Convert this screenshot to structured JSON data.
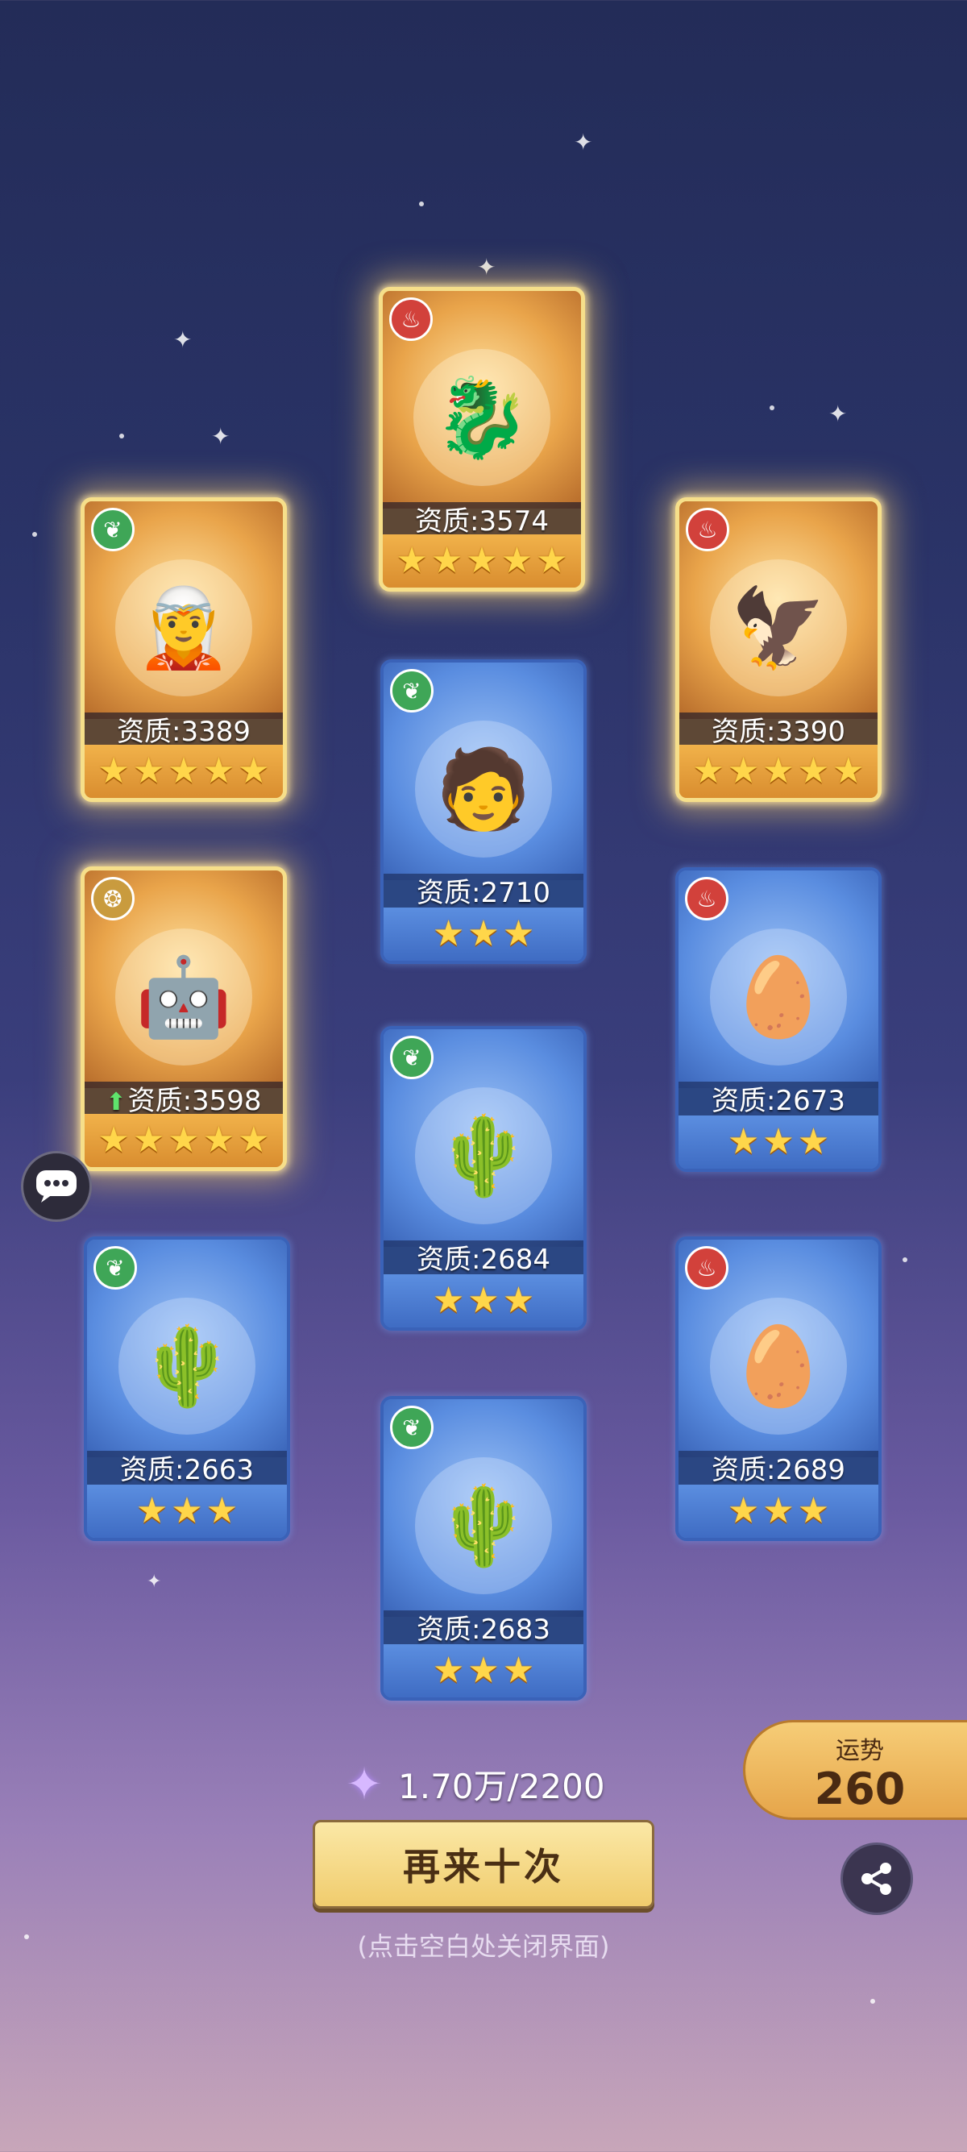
{
  "cards": [
    {
      "id": "c1",
      "rarity": "gold",
      "element": "fire",
      "element_icon": "fire-element-icon",
      "figure": "🐉",
      "quality": "资质:3574",
      "stars": 5,
      "upgrade": false
    },
    {
      "id": "c2",
      "rarity": "gold",
      "element": "nature",
      "element_icon": "nature-element-icon",
      "figure": "🧝",
      "quality": "资质:3389",
      "stars": 5,
      "upgrade": false
    },
    {
      "id": "c3",
      "rarity": "gold",
      "element": "fire",
      "element_icon": "fire-element-icon",
      "figure": "🦅",
      "quality": "资质:3390",
      "stars": 5,
      "upgrade": false
    },
    {
      "id": "c4",
      "rarity": "blue",
      "element": "nature",
      "element_icon": "nature-element-icon",
      "figure": "🧑",
      "quality": "资质:2710",
      "stars": 3,
      "upgrade": false
    },
    {
      "id": "c5",
      "rarity": "gold",
      "element": "earth",
      "element_icon": "earth-element-icon",
      "figure": "🤖",
      "quality": "资质:3598",
      "stars": 5,
      "upgrade": true
    },
    {
      "id": "c6",
      "rarity": "blue",
      "element": "fire",
      "element_icon": "fire-element-icon",
      "figure": "🥚",
      "quality": "资质:2673",
      "stars": 3,
      "upgrade": false
    },
    {
      "id": "c7",
      "rarity": "blue",
      "element": "nature",
      "element_icon": "nature-element-icon",
      "figure": "🌵",
      "quality": "资质:2684",
      "stars": 3,
      "upgrade": false
    },
    {
      "id": "c8",
      "rarity": "blue",
      "element": "nature",
      "element_icon": "nature-element-icon",
      "figure": "🌵",
      "quality": "资质:2663",
      "stars": 3,
      "upgrade": false
    },
    {
      "id": "c9",
      "rarity": "blue",
      "element": "fire",
      "element_icon": "fire-element-icon",
      "figure": "🥚",
      "quality": "资质:2689",
      "stars": 3,
      "upgrade": false
    },
    {
      "id": "c10",
      "rarity": "blue",
      "element": "nature",
      "element_icon": "nature-element-icon",
      "figure": "🌵",
      "quality": "资质:2683",
      "stars": 3,
      "upgrade": false
    }
  ],
  "currency": {
    "icon": "crystal-icon",
    "text": "1.70万/2200"
  },
  "again_button": {
    "label": "再来十次"
  },
  "hint": "(点击空白处关闭界面)",
  "fortune": {
    "label": "运势",
    "value": "260"
  },
  "colors": {
    "gold_border": "#f6df8a",
    "blue_border": "#3a62b8",
    "button": "#f0cc6d"
  }
}
